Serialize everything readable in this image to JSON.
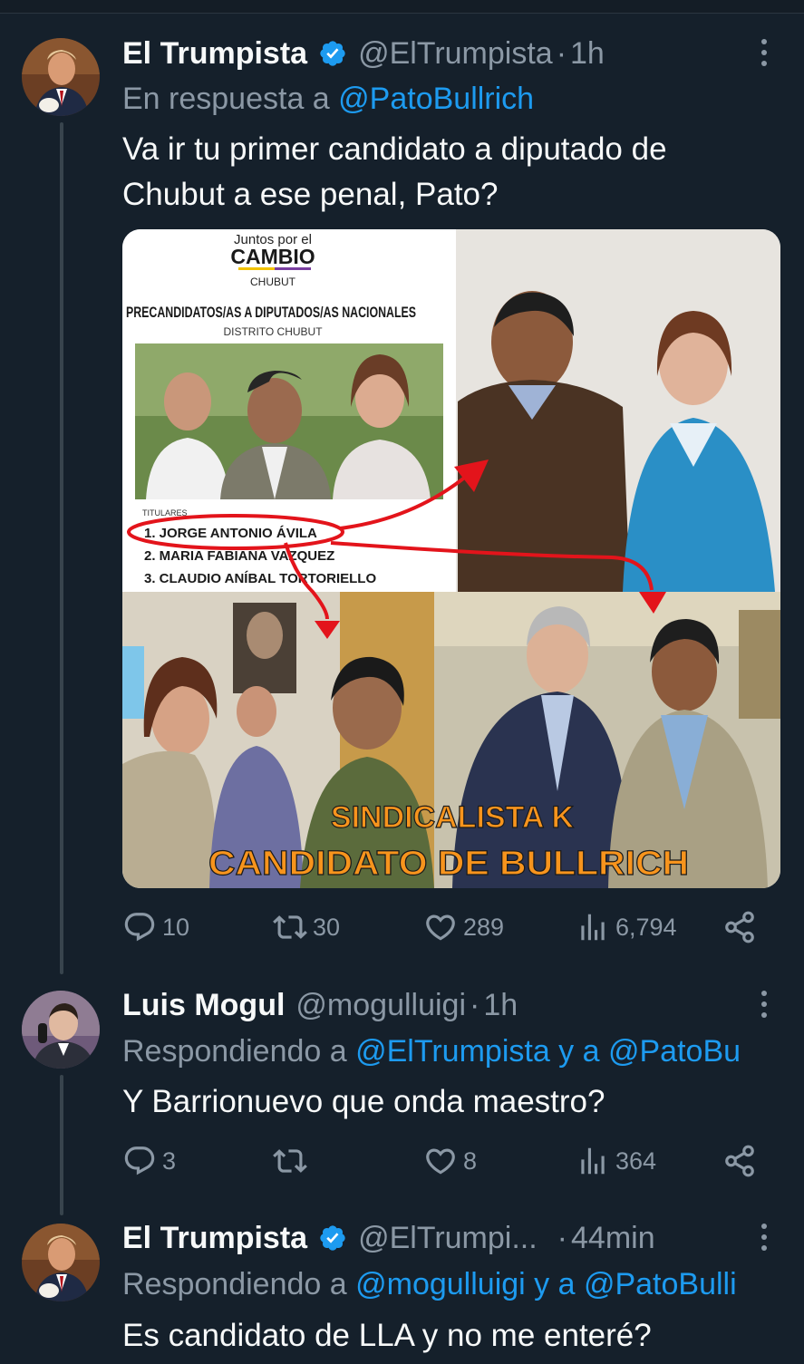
{
  "tweets": [
    {
      "name": "El Trumpista",
      "verified": true,
      "handle": "@ElTrumpista",
      "sep": "·",
      "time": "1h",
      "reply_prefix": "En respuesta a",
      "reply_mentions": "@PatoBullrich",
      "text": "Va ir tu primer candidato a diputado de Chubut a ese penal, Pato?",
      "media": {
        "logo_top": "Juntos por el",
        "logo_main": "CAMBIO",
        "logo_sub": "CHUBUT",
        "heading": "PRECANDIDATOS/AS A DIPUTADOS/AS NACIONALES",
        "district": "DISTRITO CHUBUT",
        "list_title": "TITULARES",
        "candidates": [
          "1. JORGE ANTONIO ÁVILA",
          "2. MARIA FABIANA VAZQUEZ",
          "3. CLAUDIO ANÍBAL TORTORIELLO"
        ],
        "banner_line1": "SINDICALISTA K",
        "banner_line2": "CANDIDATO DE BULLRICH"
      },
      "stats": {
        "replies": "10",
        "retweets": "30",
        "likes": "289",
        "views": "6,794"
      }
    },
    {
      "name": "Luis Mogul",
      "verified": false,
      "handle": "@mogulluigi",
      "sep": "·",
      "time": "1h",
      "reply_prefix": "Respondiendo a",
      "reply_mentions": "@ElTrumpista y a @PatoBu",
      "text": "Y Barrionuevo que onda maestro?",
      "stats": {
        "replies": "3",
        "retweets": "",
        "likes": "8",
        "views": "364"
      }
    },
    {
      "name": "El Trumpista",
      "verified": true,
      "handle": "@ElTrumpi...",
      "sep": "·",
      "time": "44min",
      "reply_prefix": "Respondiendo a",
      "reply_mentions": "@mogulluigi y a @PatoBulli",
      "text": "Es candidato de LLA y no me enteré?"
    }
  ],
  "colors": {
    "background": "#15202b",
    "text": "#f7f9f9",
    "secondary": "#8b98a5",
    "accent": "#1d9bf0",
    "banner_text": "#f7941d",
    "annotation_red": "#e3141b"
  },
  "icons": [
    "verified-badge-icon",
    "more-icon",
    "reply-icon",
    "retweet-icon",
    "like-icon",
    "views-icon",
    "share-icon"
  ]
}
